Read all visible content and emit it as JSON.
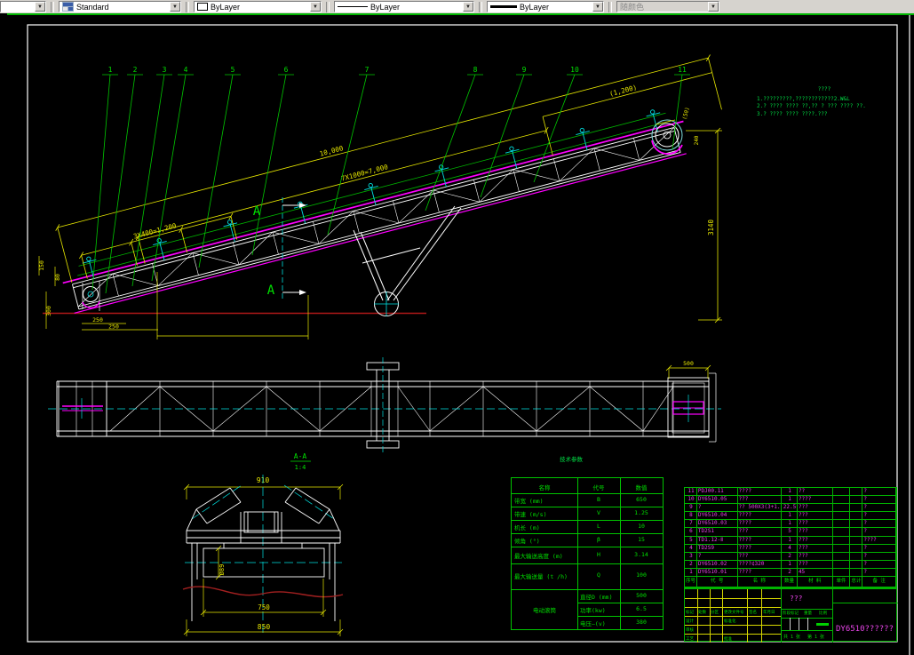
{
  "toolbar": {
    "style_value": "Standard",
    "color_value": "ByLayer",
    "linetype_value": "ByLayer",
    "lineweight_value": "ByLayer",
    "plotstyle_value": "随颜色"
  },
  "notes": {
    "title": "????",
    "line1": "1.?????????,????????????2.W&L",
    "line2": "2.? ???? ???? ??,?? ? ??? ???? ??.",
    "line3": "3.? ???? ???? ????.???"
  },
  "balloons": [
    "1",
    "2",
    "3",
    "4",
    "5",
    "6",
    "7",
    "8",
    "9",
    "10",
    "11"
  ],
  "dims": {
    "d10000": "10,000",
    "d7x1000": "7X1000=7,000",
    "d1200": "(1,200)",
    "d3x400": "3X400=1,200",
    "d150": "150",
    "d80": "80",
    "d300": "300",
    "d250a": "250",
    "d250b": "250",
    "d3140": "3140",
    "d50": "(50)",
    "d240": "240",
    "d500": "500"
  },
  "section": {
    "label": "A-A",
    "scale": "1:4",
    "marker": "A",
    "s910": "910",
    "s89": "Ø89",
    "s750": "750",
    "s850": "850"
  },
  "params": {
    "caption": "技术参数",
    "headers": [
      "名称",
      "代号",
      "数值"
    ],
    "rows": [
      {
        "name": "带宽 (mm)",
        "sym": "B",
        "val": "650"
      },
      {
        "name": "带速 (m/s)",
        "sym": "V",
        "val": "1.25"
      },
      {
        "name": "机长 (m)",
        "sym": "L",
        "val": "10"
      },
      {
        "name": "倾角 (°)",
        "sym": "β",
        "val": "15"
      },
      {
        "name": "最大输送高度 (m)",
        "sym": "H",
        "val": "3.14"
      },
      {
        "name": "最大输送量 (t /h)",
        "sym": "Q",
        "val": "100"
      }
    ],
    "motor": {
      "name": "电动滚筒",
      "sub": [
        {
          "label": "直径D (mm)",
          "val": "500"
        },
        {
          "label": "功率(kw)",
          "val": "6.5"
        },
        {
          "label": "电压—(v)",
          "val": "380"
        }
      ]
    }
  },
  "bom": {
    "headers": [
      "序号",
      "代 号",
      "名 称",
      "数量",
      "材 料",
      "单件",
      "总计",
      "备 注"
    ],
    "rows": [
      {
        "no": "11",
        "code": "PDJ00.11",
        "name": "????",
        "qty": "1",
        "mat": "??",
        "remark": "?"
      },
      {
        "no": "10",
        "code": "DY6510.05",
        "name": "???",
        "qty": "1",
        "mat": "????",
        "remark": "?"
      },
      {
        "no": "9",
        "code": "?",
        "name": "?? 500X3(3+1.5)",
        "qty": "22.5",
        "mat": "???",
        "remark": "?"
      },
      {
        "no": "8",
        "code": "DY6510.04",
        "name": "????",
        "qty": "1",
        "mat": "???",
        "remark": "?"
      },
      {
        "no": "7",
        "code": "DY6510.03",
        "name": "????",
        "qty": "1",
        "mat": "???",
        "remark": "?"
      },
      {
        "no": "6",
        "code": "TD2S1",
        "name": "???",
        "qty": "5",
        "mat": "???",
        "remark": "?"
      },
      {
        "no": "5",
        "code": "TD1.12-Ⅱ",
        "name": "????",
        "qty": "1",
        "mat": "???",
        "remark": "????"
      },
      {
        "no": "4",
        "code": "TD2S9",
        "name": "????",
        "qty": "4",
        "mat": "???",
        "remark": "?"
      },
      {
        "no": "3",
        "code": "?",
        "name": "???",
        "qty": "2",
        "mat": "???",
        "remark": "?"
      },
      {
        "no": "2",
        "code": "DY6510.02",
        "name": "????¢320",
        "qty": "1",
        "mat": "???",
        "remark": "?"
      },
      {
        "no": "1",
        "code": "DY6510.01",
        "name": "????",
        "qty": "2",
        "mat": "45",
        "remark": "?"
      }
    ]
  },
  "titleblock": {
    "title": "???",
    "drawing_no": "DY6510??????",
    "stage_label": "阶段标记",
    "weight_label": "重量",
    "scale_label": "比例",
    "sheet_label": "共 1 张",
    "page_label": "第 1 张",
    "rev_mark": "标记",
    "rev_count": "处数",
    "rev_zone": "分区",
    "rev_doc": "更改文件号",
    "rev_sign": "签名",
    "rev_date": "年月日",
    "role_design": "设计",
    "role_check": "审核",
    "role_process": "工艺",
    "role_std": "标准化",
    "role_approve": "批准"
  },
  "colors": {
    "dimension": "#e8e800",
    "annotation": "#00dd44",
    "structure": "#ffffff",
    "belt": "#ff00ff",
    "centerline": "#00ffff",
    "ground": "#b01818",
    "bom_text": "#e845e8",
    "grid_yellow": "#d8d800"
  }
}
